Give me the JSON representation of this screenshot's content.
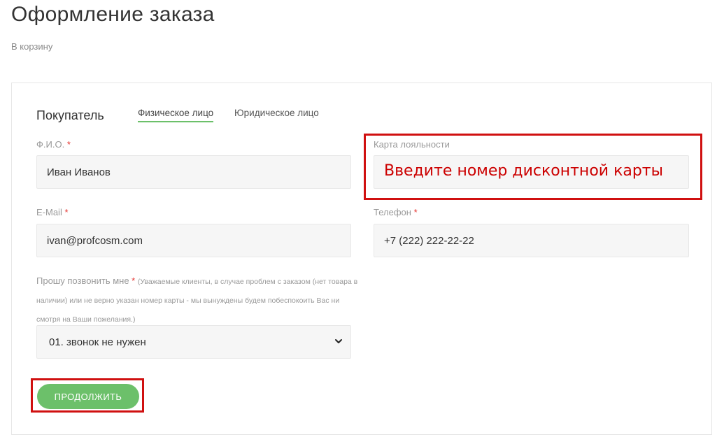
{
  "header": {
    "title": "Оформление заказа",
    "back_link": "В корзину"
  },
  "buyer": {
    "label": "Покупатель",
    "tabs": [
      {
        "label": "Физическое лицо",
        "active": true
      },
      {
        "label": "Юридическое лицо",
        "active": false
      }
    ]
  },
  "form": {
    "fio": {
      "label": "Ф.И.О.",
      "required_mark": "*",
      "value": "Иван Иванов"
    },
    "loyalty": {
      "label": "Карта лояльности",
      "placeholder": "Введите номер дисконтной карты"
    },
    "email": {
      "label": "E-Mail",
      "required_mark": "*",
      "value": "ivan@profcosm.com"
    },
    "phone": {
      "label": "Телефон",
      "required_mark": "*",
      "value": "+7 (222) 222-22-22"
    },
    "call": {
      "label": "Прошу позвонить мне",
      "required_mark": "*",
      "note": "(Уважаемые клиенты, в случае проблем с заказом (нет товара в наличии) или не верно указан номер карты - мы вынуждены будем побеспокоить Вас ни смотря на Ваши пожелания.)",
      "selected": "01. звонок не нужен"
    }
  },
  "actions": {
    "continue_label": "ПРОДОЛЖИТЬ"
  },
  "colors": {
    "accent_green": "#6cc06a",
    "highlight_red": "#d01010",
    "required_red": "#e53935"
  }
}
